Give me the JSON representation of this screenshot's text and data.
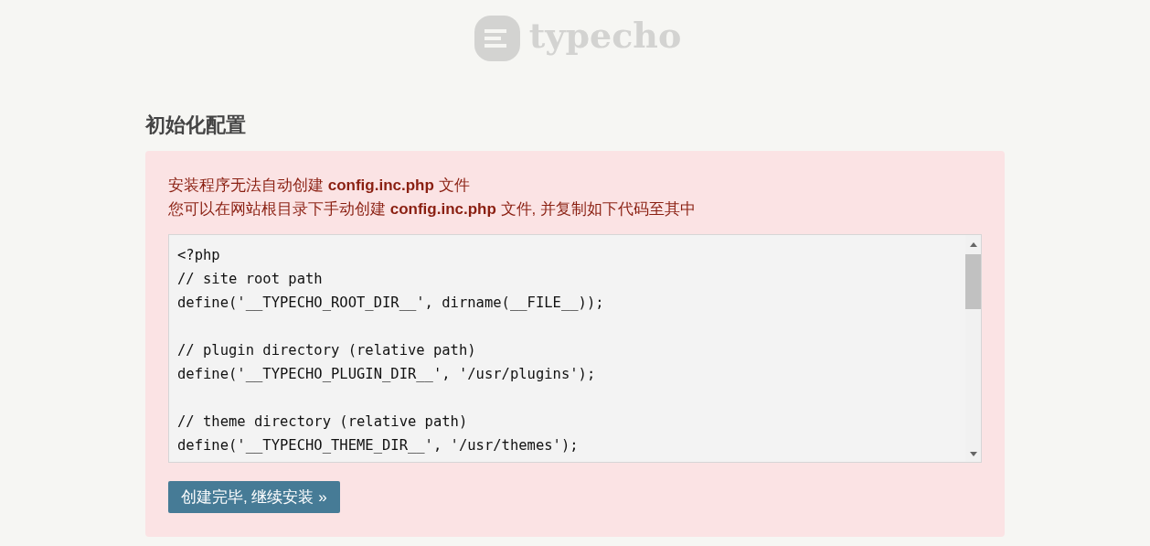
{
  "logo": {
    "text": "typecho"
  },
  "heading": "初始化配置",
  "messages": [
    "安装程序无法自动创建 **config.inc.php** 文件",
    "您可以在网站根目录下手动创建 **config.inc.php** 文件, 并复制如下代码至其中"
  ],
  "code_blocks": [
    [
      "<?php",
      "// site root path",
      "define('__TYPECHO_ROOT_DIR__', dirname(__FILE__));"
    ],
    [
      "// plugin directory (relative path)",
      "define('__TYPECHO_PLUGIN_DIR__', '/usr/plugins');"
    ],
    [
      "// theme directory (relative path)",
      "define('__TYPECHO_THEME_DIR__', '/usr/themes');"
    ]
  ],
  "button": "创建完毕, 继续安装 »"
}
